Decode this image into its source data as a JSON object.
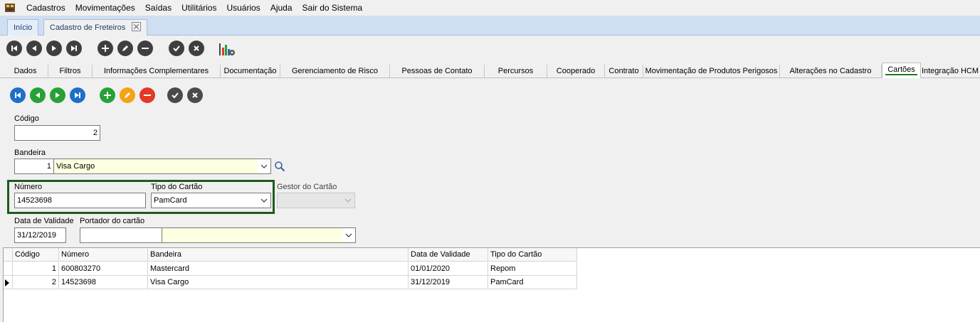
{
  "menu": {
    "items": [
      "Cadastros",
      "Movimentações",
      "Saídas",
      "Utilitários",
      "Usuários",
      "Ajuda",
      "Sair do Sistema"
    ]
  },
  "doc_tabs": [
    {
      "label": "Início"
    },
    {
      "label": "Cadastro de Freteiros"
    }
  ],
  "section_tabs": [
    "Dados",
    "Filtros",
    "Informações Complementares",
    "Documentação",
    "Gerenciamento de Risco",
    "Pessoas de Contato",
    "Percursos",
    "Cooperado",
    "Contrato",
    "Movimentação de Produtos Perigosos",
    "Alterações no Cadastro",
    "Cartões",
    "Integração HCM"
  ],
  "active_section": "Cartões",
  "form": {
    "codigo": {
      "label": "Código",
      "value": "2"
    },
    "bandeira": {
      "label": "Bandeira",
      "code": "1",
      "name": "Visa Cargo"
    },
    "numero": {
      "label": "Número",
      "value": "14523698"
    },
    "tipo_cartao": {
      "label": "Tipo do Cartão",
      "value": "PamCard"
    },
    "gestor_cartao": {
      "label": "Gestor do Cartão",
      "value": ""
    },
    "data_validade": {
      "label": "Data de Validade",
      "value": "31/12/2019"
    },
    "portador": {
      "label": "Portador do cartão",
      "code": "",
      "name": ""
    }
  },
  "grid": {
    "columns": [
      "Código",
      "Número",
      "Bandeira",
      "Data de Validade",
      "Tipo do Cartão"
    ],
    "rows": [
      {
        "codigo": "1",
        "numero": "600803270",
        "bandeira": "Mastercard",
        "validade": "01/01/2020",
        "tipo": "Repom"
      },
      {
        "codigo": "2",
        "numero": "14523698",
        "bandeira": "Visa Cargo",
        "validade": "31/12/2019",
        "tipo": "PamCard"
      }
    ],
    "current_row": 1
  },
  "colors": {
    "highlight_border": "#1e5a1e",
    "nav_blue": "#1d6fc9",
    "add_green": "#27a136",
    "edit_orange": "#f3a316",
    "delete_red": "#e23a24"
  }
}
